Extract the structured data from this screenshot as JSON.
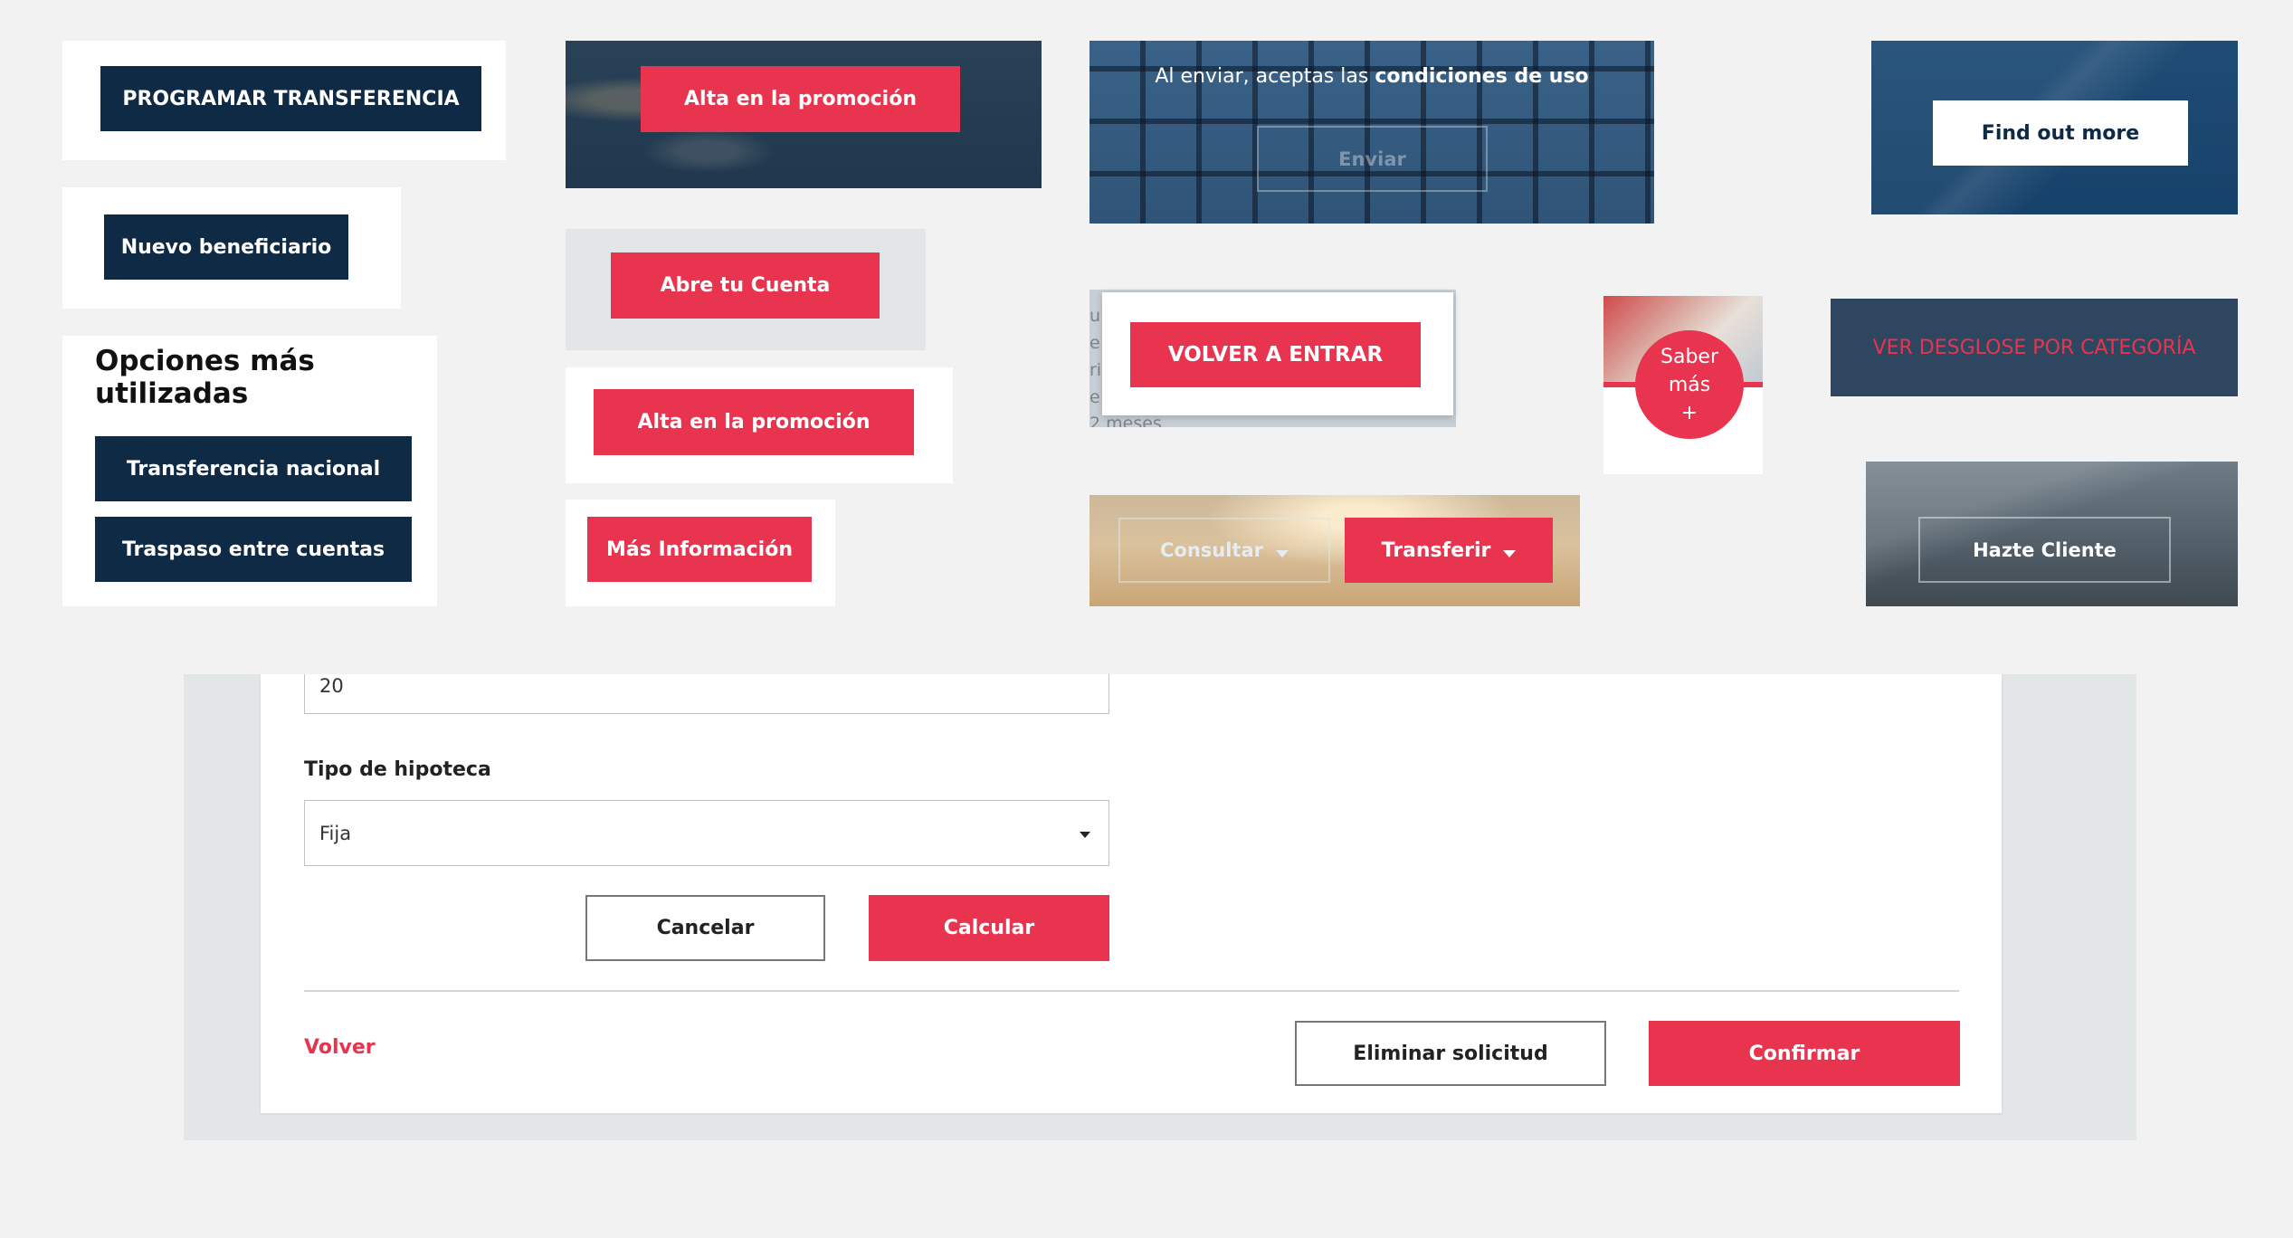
{
  "colors": {
    "navy": "#0f2a45",
    "red": "#e8344f",
    "slate": "#2f4660",
    "page_bg": "#f2f2f2"
  },
  "card1": {
    "button": "PROGRAMAR TRANSFERENCIA"
  },
  "card2": {
    "button": "Nuevo beneficiario"
  },
  "card3": {
    "title": "Opciones más utilizadas",
    "buttons": [
      "Transferencia nacional",
      "Traspaso entre cuentas"
    ]
  },
  "promo_photo": {
    "button": "Alta en la promoción"
  },
  "open_account": {
    "button": "Abre tu Cuenta"
  },
  "promo_white": {
    "button": "Alta en la promoción"
  },
  "more_info": {
    "button": "Más Información"
  },
  "keyboard_banner": {
    "text_prefix": "Al enviar, aceptas las ",
    "text_bold": "condiciones de uso",
    "button": "Enviar"
  },
  "relogin": {
    "button": "VOLVER A ENTRAR",
    "side_letters": [
      "u",
      "e",
      "ri",
      "e"
    ],
    "bottom_text": "2 meses"
  },
  "saber_mas": {
    "line1": "Saber",
    "line2": "más",
    "line3": "+"
  },
  "sunset_banner": {
    "consultar": "Consultar",
    "transferir": "Transferir",
    "chevron_icon": "chevron-down-icon"
  },
  "find_out": {
    "button": "Find out more"
  },
  "category": {
    "button": "VER DESGLOSE POR CATEGORÍA"
  },
  "hazte": {
    "button": "Hazte Cliente"
  },
  "form": {
    "years_value": "20",
    "mortgage_label": "Tipo de hipoteca",
    "mortgage_value": "Fija",
    "cancel": "Cancelar",
    "calculate": "Calcular",
    "back": "Volver",
    "delete": "Eliminar solicitud",
    "confirm": "Confirmar"
  }
}
